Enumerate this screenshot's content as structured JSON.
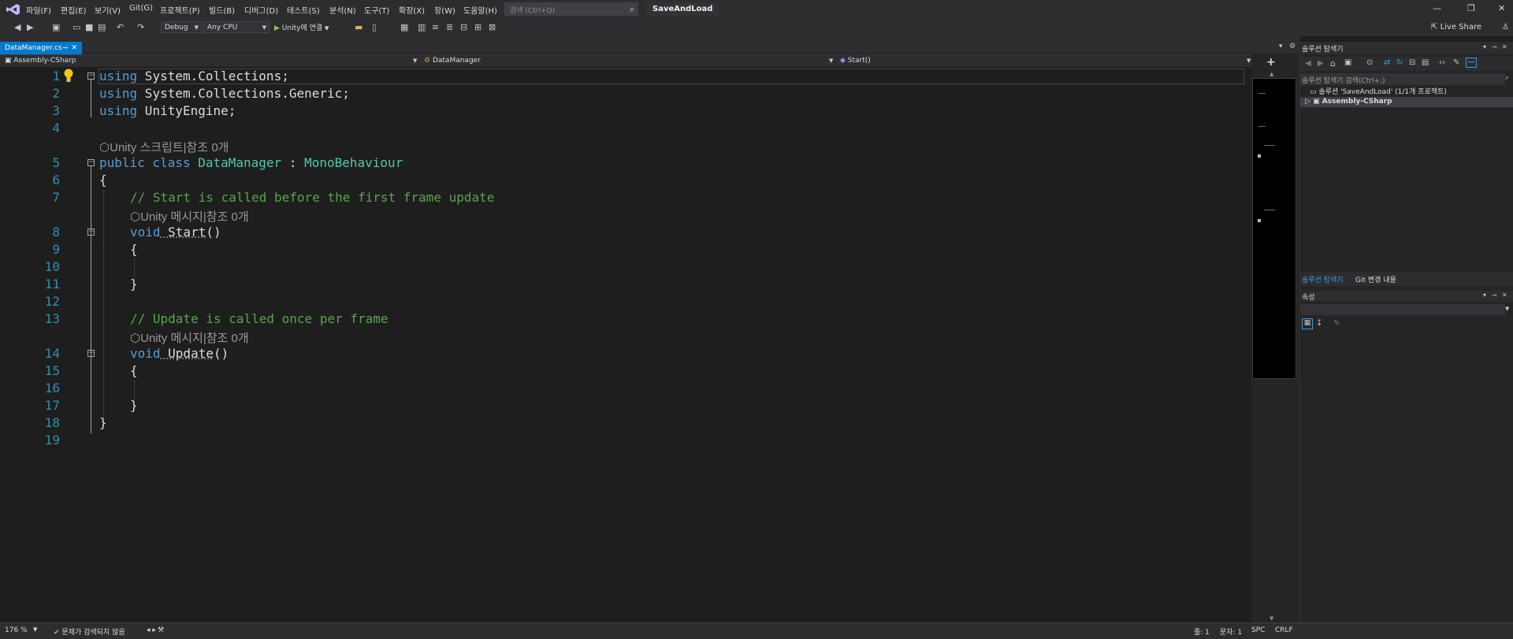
{
  "menu": {
    "items": [
      "파일(F)",
      "편집(E)",
      "보기(V)",
      "Git(G)",
      "프로젝트(P)",
      "빌드(B)",
      "디버그(D)",
      "테스트(S)",
      "분석(N)",
      "도구(T)",
      "확장(X)",
      "창(W)",
      "도움말(H)"
    ],
    "search_placeholder": "검색 (Ctrl+Q)",
    "solution_title": "SaveAndLoad"
  },
  "toolbar": {
    "config": "Debug",
    "platform": "Any CPU",
    "run_label": "Unity에 연결",
    "live_share": "Live Share"
  },
  "tabs": {
    "active_file": "DataManager.cs"
  },
  "navbar": {
    "project": "Assembly-CSharp",
    "class": "DataManager",
    "member": "Start()"
  },
  "editor": {
    "line_numbers": [
      "1",
      "2",
      "3",
      "4",
      "5",
      "6",
      "7",
      "8",
      "9",
      "10",
      "11",
      "12",
      "13",
      "14",
      "15",
      "16",
      "17",
      "18",
      "19"
    ],
    "lines": {
      "l1_kw": "using",
      "l1_rest": " System.Collections;",
      "l2_kw": "using",
      "l2_rest": " System.Collections.Generic;",
      "l3_kw": "using",
      "l3_rest": " UnityEngine;",
      "lens_class": "Unity 스크립트|참조 0개",
      "l5_kw": "public class",
      "l5_name": " DataManager",
      "l5_colon": " : ",
      "l5_base": "MonoBehaviour",
      "l6": "{",
      "l7_comment": "// Start is called before the first frame update",
      "lens_start": "Unity 메시지|참조 0개",
      "l8_kw": "void",
      "l8_name": " Start",
      "l8_paren": "()",
      "l9": "{",
      "l11": "}",
      "l13_comment": "// Update is called once per frame",
      "lens_update": "Unity 메시지|참조 0개",
      "l14_kw": "void",
      "l14_name": " Update",
      "l14_paren": "()",
      "l15": "{",
      "l17": "}",
      "l18": "}"
    }
  },
  "solution_explorer": {
    "title": "솔루션 탐색기",
    "search_placeholder": "솔루션 탐색기 검색(Ctrl+;)",
    "solution_item": "솔루션 'SaveAndLoad' (1/1개 프로젝트)",
    "project_item": "Assembly-CSharp",
    "tab_se": "솔루션 탐색기",
    "tab_git": "Git 변경 내용"
  },
  "properties": {
    "title": "속성"
  },
  "statusbar": {
    "zoom": "176 %",
    "issues": "문제가 검색되지 않음",
    "line": "줄: 1",
    "char": "문자: 1",
    "spc": "SPC",
    "crlf": "CRLF"
  },
  "colors": {
    "accent": "#007acc",
    "keyword": "#569cd6",
    "type": "#4ec9b0",
    "comment": "#57a64a",
    "line_number": "#2b91af"
  }
}
